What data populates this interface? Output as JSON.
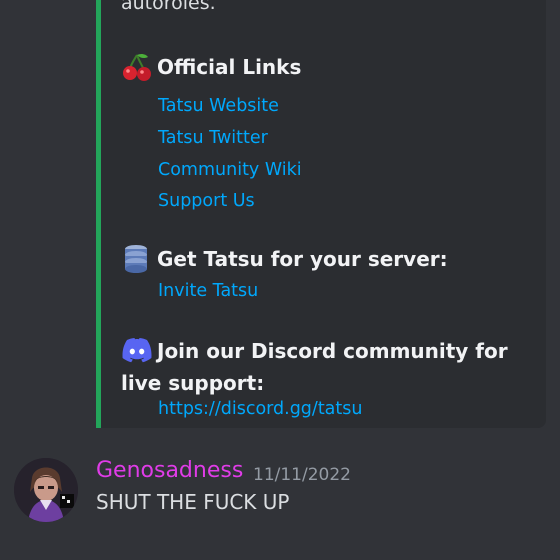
{
  "embed": {
    "cut_text": "autoroles.",
    "official_links": {
      "title": "Official Links",
      "icon": "cherries-icon",
      "links": [
        "Tatsu Website",
        "Tatsu Twitter",
        "Community Wiki",
        "Support Us"
      ]
    },
    "get_tatsu": {
      "title": "Get Tatsu for your server:",
      "icon": "database-icon",
      "link": "Invite Tatsu"
    },
    "discord_community": {
      "title": "Join our Discord community for live support:",
      "icon": "discord-icon",
      "link": "https://discord.gg/tatsu"
    },
    "accent_color": "#23a55a"
  },
  "message": {
    "username": "Genosadness",
    "timestamp": "11/11/2022",
    "text": "SHUT THE FUCK UP",
    "username_color": "#e03ce8"
  }
}
